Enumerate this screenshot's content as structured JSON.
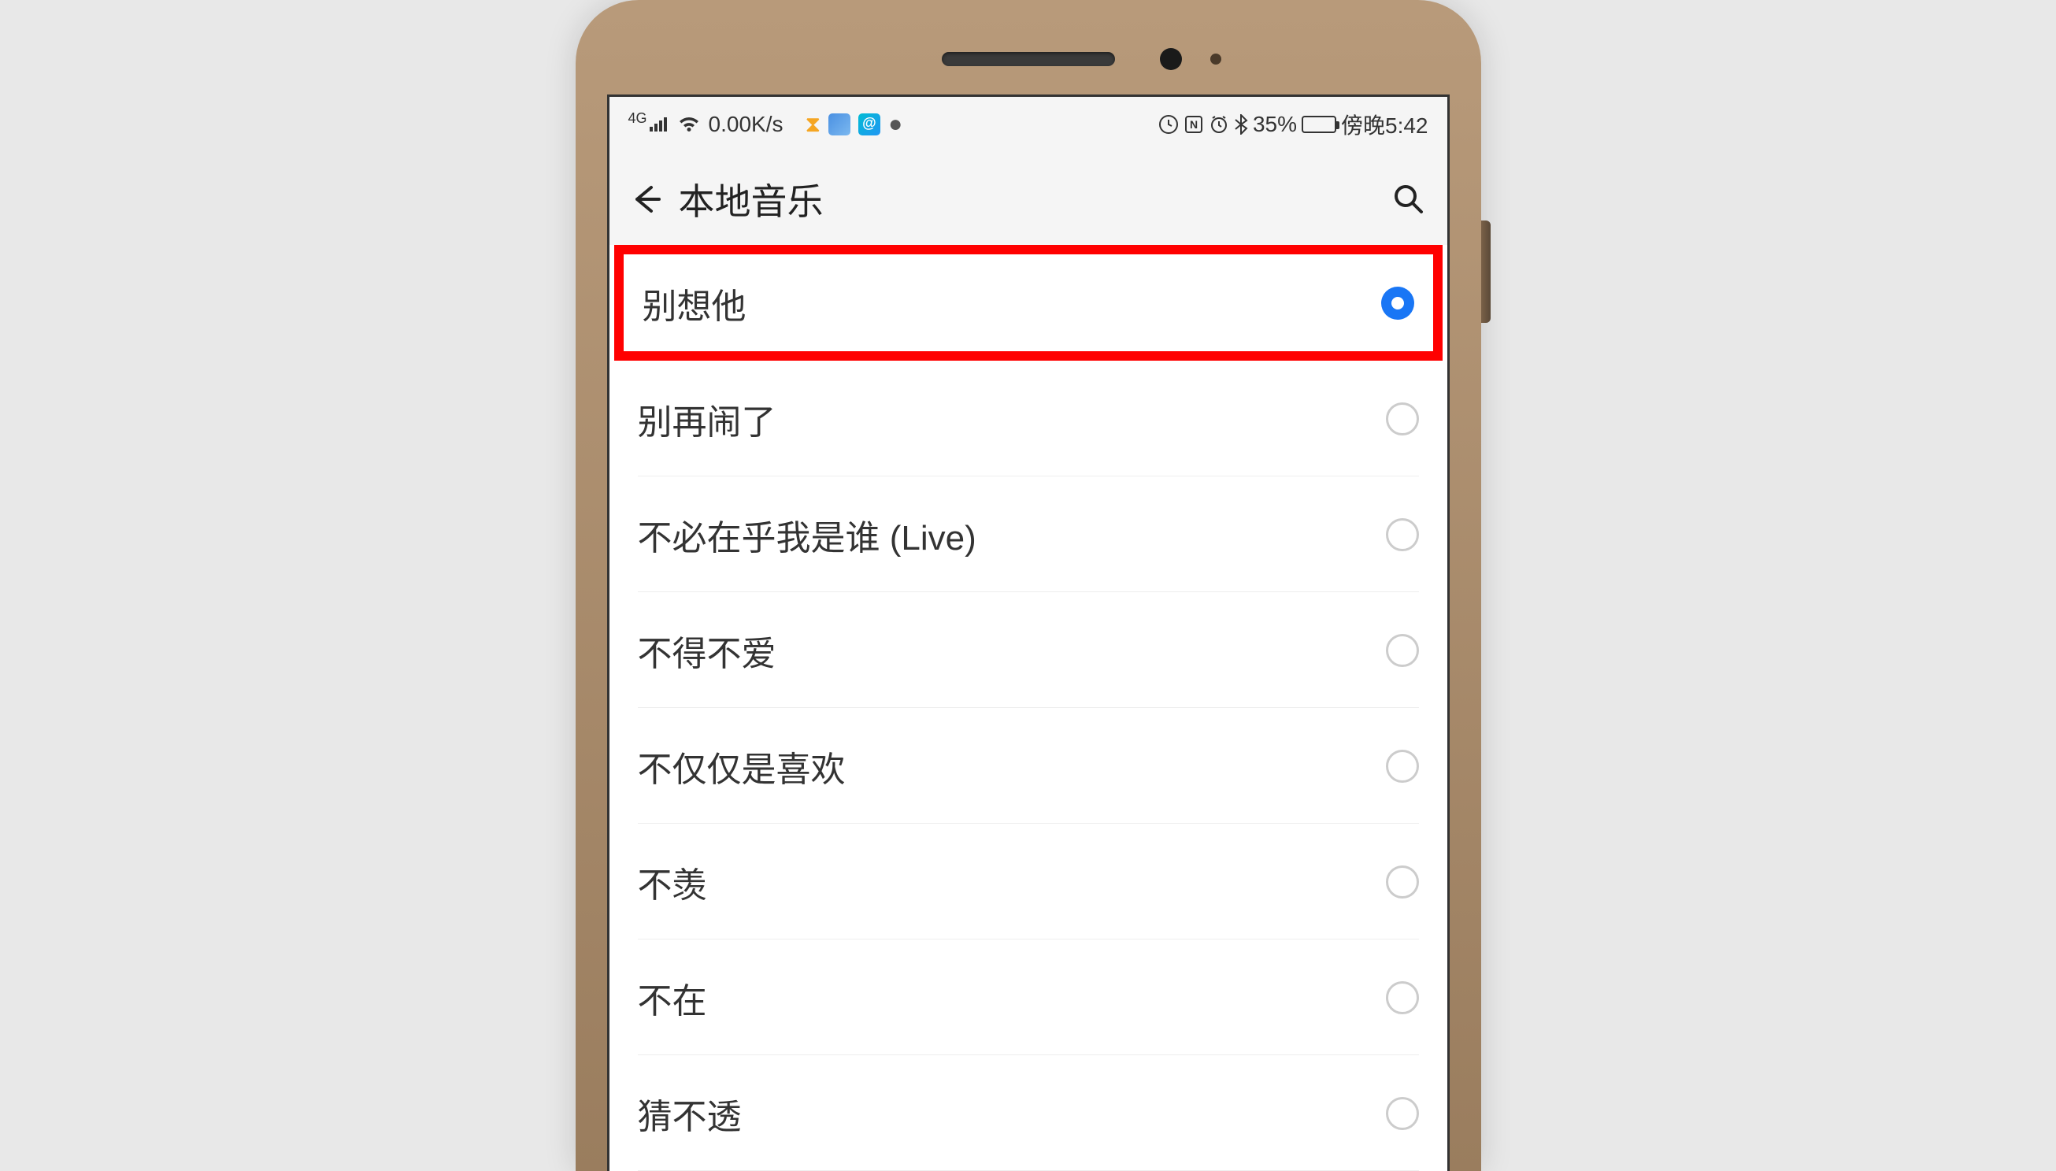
{
  "status_bar": {
    "signal_type": "4G",
    "net_speed": "0.00K/s",
    "battery_percent": "35%",
    "time": "傍晚5:42"
  },
  "header": {
    "title": "本地音乐"
  },
  "list": [
    {
      "title": "别想他",
      "selected": true,
      "highlighted": true
    },
    {
      "title": "别再闹了",
      "selected": false,
      "highlighted": false
    },
    {
      "title": "不必在乎我是谁 (Live)",
      "selected": false,
      "highlighted": false
    },
    {
      "title": "不得不爱",
      "selected": false,
      "highlighted": false
    },
    {
      "title": "不仅仅是喜欢",
      "selected": false,
      "highlighted": false
    },
    {
      "title": "不羡",
      "selected": false,
      "highlighted": false
    },
    {
      "title": "不在",
      "selected": false,
      "highlighted": false
    },
    {
      "title": "猜不透",
      "selected": false,
      "highlighted": false
    }
  ]
}
